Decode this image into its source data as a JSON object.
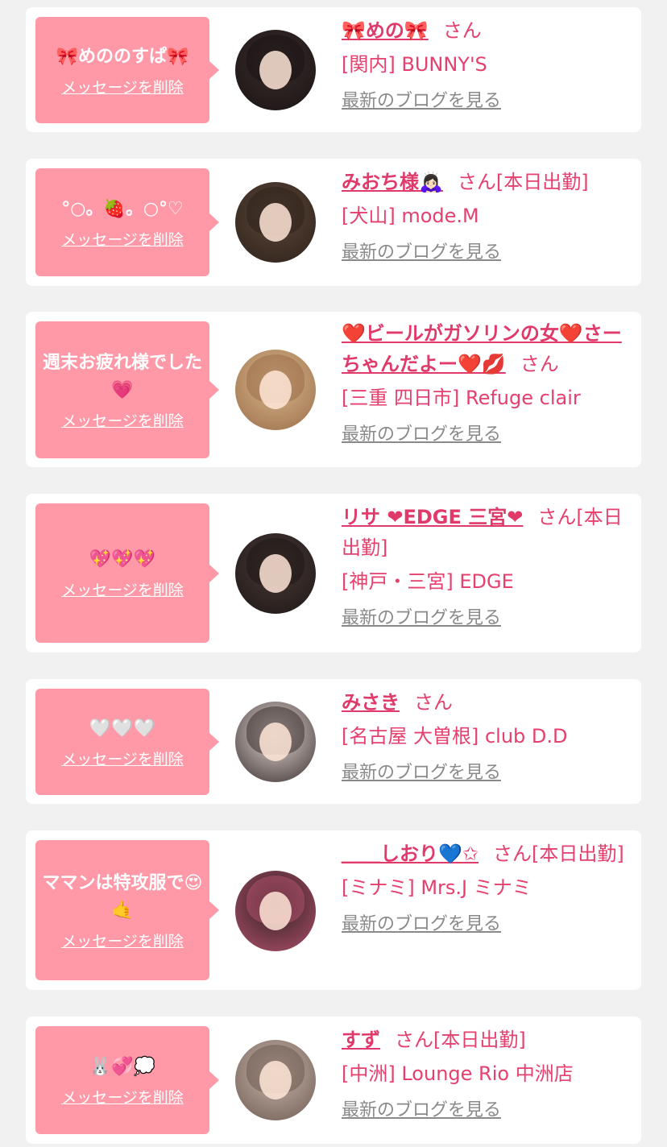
{
  "delete_label": "メッセージを削除",
  "blog_label": "最新のブログを見る",
  "san_label": "さん",
  "colors": {
    "background": "#f1f1f1",
    "bubble": "#ff99a8",
    "accent": "#e03a6a",
    "link_gray": "#8a8a8a"
  },
  "messages": [
    {
      "message": "🎀めののすぱ🎀",
      "name": "🎀めの🎀",
      "suffix": "",
      "shop": "[関内] BUNNY'S",
      "avatar_colors": [
        "#3a2c2c",
        "#1a1414"
      ]
    },
    {
      "message": "°○。🍓。○°♡",
      "name": "みおち様🙇🏻‍♀️",
      "suffix": "[本日出勤]",
      "shop": "[犬山] mode.M",
      "avatar_colors": [
        "#5b4638",
        "#2e221b"
      ]
    },
    {
      "message": "週末お疲れ様でした💗",
      "name": "❤️ビールがガソリンの女❤️さーちゃんだよー❤️💋",
      "suffix": "",
      "shop": "[三重 四日市] Refuge clair",
      "avatar_colors": [
        "#d9b98c",
        "#9a6d4a"
      ]
    },
    {
      "message": "💖💖💖",
      "name": "リサ ❤EDGE 三宮❤",
      "suffix": "[本日出勤]",
      "shop": "[神戸・三宮] EDGE",
      "avatar_colors": [
        "#4a3a36",
        "#1d1716"
      ]
    },
    {
      "message": "🤍🤍🤍",
      "name": "みさき",
      "suffix": "",
      "shop": "[名古屋 大曽根] club D.D",
      "avatar_colors": [
        "#e8dcd8",
        "#3a302e"
      ]
    },
    {
      "message": "ママンは特攻服で😍🤙",
      "name": "＿＿しおり💙✩",
      "suffix": "[本日出勤]",
      "shop": "[ミナミ] Mrs.J ミナミ",
      "avatar_colors": [
        "#2b1f22",
        "#b0506a"
      ]
    },
    {
      "message": "🐰💞💭",
      "name": "すず",
      "suffix": "[本日出勤]",
      "shop": "[中洲] Lounge Rio 中洲店",
      "avatar_colors": [
        "#c9b8b0",
        "#6e5a50"
      ]
    }
  ]
}
